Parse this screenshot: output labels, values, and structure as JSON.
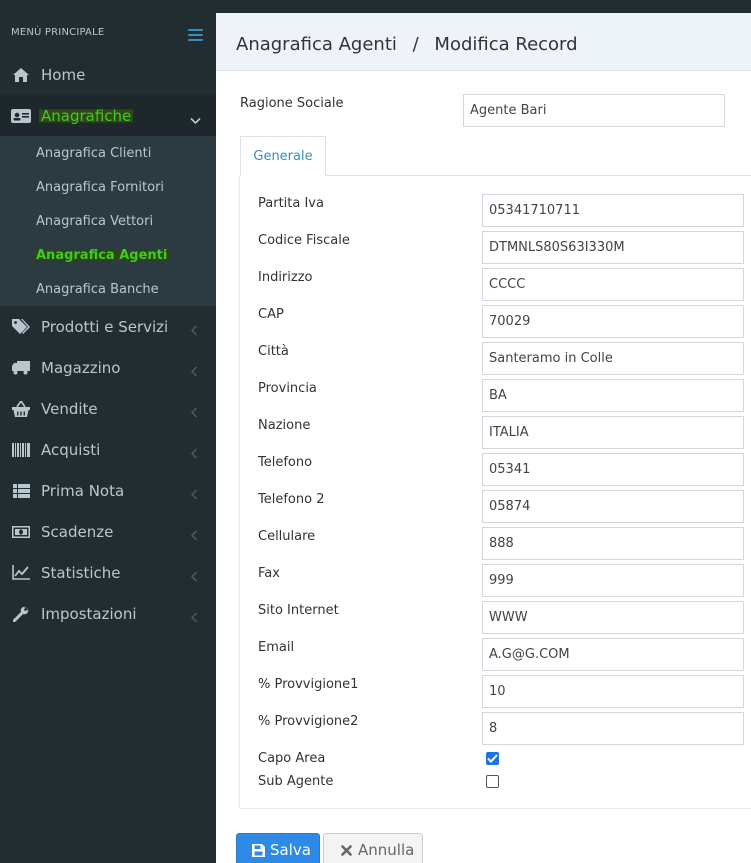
{
  "sidebar": {
    "header": "MENÙ PRINCIPALE",
    "items": [
      {
        "label": "Home",
        "icon": "home-icon"
      },
      {
        "label": "Anagrafiche",
        "icon": "id-card-icon"
      },
      {
        "label": "Prodotti e Servizi",
        "icon": "tags-icon"
      },
      {
        "label": "Magazzino",
        "icon": "truck-icon"
      },
      {
        "label": "Vendite",
        "icon": "basket-icon"
      },
      {
        "label": "Acquisti",
        "icon": "barcode-icon"
      },
      {
        "label": "Prima Nota",
        "icon": "list-icon"
      },
      {
        "label": "Scadenze",
        "icon": "money-icon"
      },
      {
        "label": "Statistiche",
        "icon": "line-chart-icon"
      },
      {
        "label": "Impostazioni",
        "icon": "wrench-icon"
      }
    ],
    "subitems": [
      {
        "label": "Anagrafica Clienti"
      },
      {
        "label": "Anagrafica Fornitori"
      },
      {
        "label": "Anagrafica Vettori"
      },
      {
        "label": "Anagrafica Agenti"
      },
      {
        "label": "Anagrafica Banche"
      }
    ]
  },
  "header": {
    "section": "Anagrafica Agenti",
    "separator": "/",
    "page": "Modifica Record"
  },
  "form": {
    "ragione_sociale_label": "Ragione Sociale",
    "ragione_sociale_value": "Agente Bari",
    "tab_label": "Generale",
    "fields": [
      {
        "label": "Partita Iva",
        "value": "05341710711"
      },
      {
        "label": "Codice Fiscale",
        "value": "DTMNLS80S63I330M"
      },
      {
        "label": "Indirizzo",
        "value": "CCCC"
      },
      {
        "label": "CAP",
        "value": "70029"
      },
      {
        "label": "Città",
        "value": "Santeramo in Colle"
      },
      {
        "label": "Provincia",
        "value": "BA"
      },
      {
        "label": "Nazione",
        "value": "ITALIA"
      },
      {
        "label": "Telefono",
        "value": "05341"
      },
      {
        "label": "Telefono 2",
        "value": "05874"
      },
      {
        "label": "Cellulare",
        "value": "888"
      },
      {
        "label": "Fax",
        "value": "999"
      },
      {
        "label": "Sito Internet",
        "value": "WWW"
      },
      {
        "label": "Email",
        "value": "A.G@G.COM"
      },
      {
        "label": "% Provvigione1",
        "value": "10"
      },
      {
        "label": "% Provvigione2",
        "value": "8"
      }
    ],
    "capo_area_label": "Capo Area",
    "capo_area_checked": true,
    "sub_agente_label": "Sub Agente",
    "sub_agente_checked": false
  },
  "buttons": {
    "save": "Salva",
    "cancel": "Annulla"
  },
  "colors": {
    "sidebar_bg": "#222d32",
    "active_text": "#3fcc1f",
    "accent": "#3c8dbc",
    "save_button": "#2e8ae6"
  }
}
